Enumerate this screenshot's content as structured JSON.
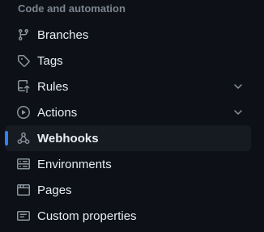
{
  "section": {
    "heading": "Code and automation"
  },
  "items": [
    {
      "label": "Branches",
      "icon": "git-branch-icon",
      "expandable": false,
      "active": false
    },
    {
      "label": "Tags",
      "icon": "tag-icon",
      "expandable": false,
      "active": false
    },
    {
      "label": "Rules",
      "icon": "repo-push-icon",
      "expandable": true,
      "active": false
    },
    {
      "label": "Actions",
      "icon": "play-icon",
      "expandable": true,
      "active": false
    },
    {
      "label": "Webhooks",
      "icon": "webhook-icon",
      "expandable": false,
      "active": true
    },
    {
      "label": "Environments",
      "icon": "server-icon",
      "expandable": false,
      "active": false
    },
    {
      "label": "Pages",
      "icon": "browser-icon",
      "expandable": false,
      "active": false
    },
    {
      "label": "Custom properties",
      "icon": "note-icon",
      "expandable": false,
      "active": false
    }
  ],
  "colors": {
    "background": "#0d1117",
    "active_background": "#161b22",
    "accent": "#2f81f7",
    "text": "#e6edf3",
    "muted": "#7d8590"
  }
}
